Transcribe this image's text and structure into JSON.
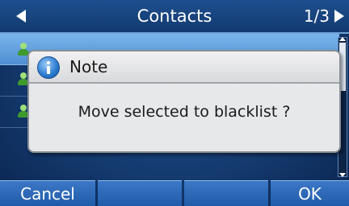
{
  "titlebar": {
    "title": "Contacts",
    "page_indicator": "1/3",
    "left_arrow_icon": "left-arrow-icon",
    "right_arrow_icon": "right-arrow-icon"
  },
  "list": {
    "rows": [
      {
        "icon": "contact-icon",
        "selected": true
      },
      {
        "icon": "contact-icon",
        "selected": false
      },
      {
        "icon": "contact-icon",
        "selected": false
      }
    ]
  },
  "dialog": {
    "icon": "info-icon",
    "title": "Note",
    "message": "Move selected to blacklist ?"
  },
  "softkeys": {
    "key1": "Cancel",
    "key2": "",
    "key3": "",
    "key4": "OK"
  },
  "colors": {
    "background": "#163e74",
    "dialog": "#e7e8ea",
    "softkey": "#2a66b5",
    "selected_row": "#6aa8e4"
  }
}
